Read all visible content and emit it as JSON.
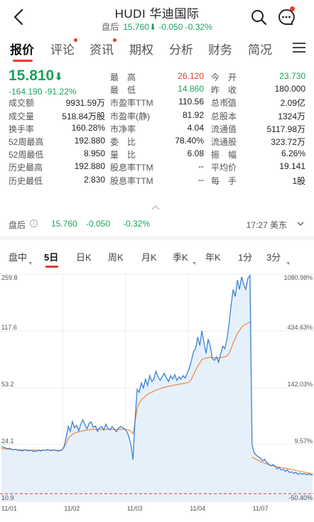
{
  "header": {
    "title": "HUDI 华迪国际",
    "after_hours_label": "盘后",
    "after_hours_price": "15.760",
    "after_hours_change": "-0.050",
    "after_hours_pct": "-0.32%"
  },
  "tabs": [
    {
      "label": "报价",
      "active": true
    },
    {
      "label": "评论",
      "dot": true
    },
    {
      "label": "资讯",
      "dot": true
    },
    {
      "label": "期权"
    },
    {
      "label": "分析"
    },
    {
      "label": "财务"
    },
    {
      "label": "简况"
    }
  ],
  "quote": {
    "price": "15.810",
    "change": "-164.190",
    "change_pct": "-91.22%",
    "col2": [
      {
        "label": "最　高",
        "value": "26.120",
        "color": "red"
      },
      {
        "label": "最　低",
        "value": "14.860",
        "color": "green"
      },
      {
        "label": "市盈率TTM",
        "value": "110.56"
      },
      {
        "label": "市盈率(静)",
        "value": "81.92"
      },
      {
        "label": "市净率",
        "value": "4.04"
      },
      {
        "label": "委　比",
        "value": "78.40%"
      },
      {
        "label": "量　比",
        "value": "6.08"
      },
      {
        "label": "股息率TTM",
        "value": "--"
      },
      {
        "label": "股息率TTM",
        "value": "--"
      }
    ],
    "col1": [
      {
        "label": "成交额",
        "value": "9931.59万"
      },
      {
        "label": "成交量",
        "value": "518.84万股"
      },
      {
        "label": "换手率",
        "value": "160.28%"
      },
      {
        "label": "52周最高",
        "value": "192.880"
      },
      {
        "label": "52周最低",
        "value": "8.950"
      },
      {
        "label": "历史最高",
        "value": "192.880"
      },
      {
        "label": "历史最低",
        "value": "2.830"
      }
    ],
    "col3": [
      {
        "label": "今　开",
        "value": "23.730",
        "color": "green"
      },
      {
        "label": "昨　收",
        "value": "180.000"
      },
      {
        "label": "总市值",
        "value": "2.09亿",
        "info": true
      },
      {
        "label": "总股本",
        "value": "1324万"
      },
      {
        "label": "流通值",
        "value": "5117.98万"
      },
      {
        "label": "流通股",
        "value": "323.72万"
      },
      {
        "label": "振　幅",
        "value": "6.26%"
      },
      {
        "label": "平均价",
        "value": "19.141"
      },
      {
        "label": "每　手",
        "value": "1股"
      }
    ]
  },
  "after_hours_row": {
    "label": "盘后",
    "price": "15.760",
    "change": "-0.050",
    "pct": "-0.32%",
    "time": "17:27 美东"
  },
  "chart_tabs": [
    {
      "label": "盘中",
      "dropdown": true
    },
    {
      "label": "5日",
      "active": true
    },
    {
      "label": "日K"
    },
    {
      "label": "周K"
    },
    {
      "label": "月K"
    },
    {
      "label": "季K",
      "dropdown": true
    },
    {
      "label": "年K"
    },
    {
      "label": "1分"
    },
    {
      "label": "3分",
      "dropdown": true
    }
  ],
  "chart_data": {
    "type": "line",
    "y_left_ticks": [
      "259.8",
      "117.6",
      "53.2",
      "24.1",
      "10.9"
    ],
    "y_right_ticks": [
      "1080.98%",
      "434.63%",
      "142.03%",
      "9.57%",
      "-50.40%"
    ],
    "x_dates": [
      "11/01",
      "11/02",
      "11/03",
      "11/04",
      "11/07"
    ],
    "ylim": [
      10.9,
      259.8
    ],
    "log_scale": true,
    "prev_close": 22.0,
    "series": [
      {
        "color": "#3b82d6",
        "values": [
          23.5,
          23.2,
          23.0,
          22.7,
          22.9,
          22.5,
          22.4,
          22.6,
          22.2,
          22.3,
          22.0,
          22.4,
          22.2,
          22.1,
          22.3,
          22.0,
          21.9,
          22.1,
          22.2,
          22.0,
          22.4,
          22.2,
          22.5,
          22.3,
          22.1,
          22.4,
          22.2,
          22.0,
          22.1,
          22.3,
          23.4,
          26.5,
          31.0,
          29.0,
          33.2,
          30.5,
          31.5,
          29.2,
          32.0,
          34.0,
          31.8,
          30.0,
          32.5,
          33.0,
          30.6,
          31.2,
          29.0,
          30.5,
          31.0,
          29.5,
          32.0,
          30.2,
          29.6,
          31.0,
          30.0,
          28.8,
          30.2,
          31.0,
          30.5,
          30.0,
          29.0,
          27.0,
          24.0,
          19.5,
          34.0,
          52.0,
          50.0,
          57.0,
          53.0,
          60.0,
          55.0,
          63.0,
          58.0,
          60.0,
          67.0,
          62.0,
          59.0,
          62.0,
          65.0,
          61.0,
          58.0,
          63.0,
          60.0,
          64.0,
          59.0,
          62.0,
          60.0,
          63.0,
          61.0,
          65.0,
          70.0,
          78.0,
          88.0,
          92.0,
          108.0,
          96.0,
          118.0,
          100.0,
          86.0,
          105.0,
          95.0,
          80.0,
          78.0,
          82.0,
          76.0,
          86.0,
          95.0,
          92.0,
          105.0,
          130.0,
          170.0,
          210.0,
          190.0,
          240.0,
          210.0,
          250.0,
          225.0,
          210.0,
          245.0,
          255.0,
          24.0,
          21.5,
          20.8,
          20.3,
          20.0,
          19.2,
          19.6,
          18.8,
          18.4,
          17.9,
          18.2,
          17.8,
          17.2,
          17.5,
          16.9,
          17.1,
          16.6,
          16.9,
          16.3,
          16.5,
          16.1,
          16.4,
          15.9,
          16.2,
          15.9,
          16.1,
          15.8,
          16.0,
          15.8,
          15.8
        ]
      },
      {
        "color": "#f0883c",
        "values": [
          22.8,
          22.7,
          22.7,
          22.6,
          22.6,
          22.5,
          22.5,
          22.5,
          22.4,
          22.4,
          22.4,
          22.4,
          22.4,
          22.3,
          22.3,
          22.3,
          22.3,
          22.3,
          22.3,
          22.3,
          22.3,
          22.3,
          22.3,
          22.3,
          22.3,
          22.3,
          22.3,
          22.3,
          22.3,
          22.3,
          23.2,
          24.5,
          26.2,
          27.0,
          27.8,
          28.2,
          28.6,
          28.8,
          29.0,
          29.2,
          29.4,
          29.5,
          29.6,
          29.7,
          29.8,
          29.8,
          29.8,
          29.8,
          29.8,
          29.8,
          29.8,
          29.8,
          29.8,
          29.8,
          29.8,
          29.8,
          29.8,
          29.8,
          29.8,
          29.8,
          29.7,
          29.5,
          29.0,
          28.0,
          33.0,
          40.0,
          43.0,
          45.0,
          46.0,
          47.5,
          48.5,
          49.5,
          50.0,
          50.8,
          51.5,
          52.0,
          52.5,
          53.0,
          53.5,
          54.0,
          54.2,
          54.6,
          55.0,
          55.3,
          55.6,
          55.9,
          56.2,
          56.5,
          56.8,
          57.0,
          58.0,
          60.0,
          64.0,
          68.0,
          72.0,
          75.0,
          79.0,
          80.0,
          80.5,
          81.0,
          81.5,
          81.2,
          81.0,
          80.8,
          80.5,
          80.8,
          81.5,
          82.0,
          83.0,
          86.0,
          92.0,
          100.0,
          106.0,
          114.0,
          118.0,
          124.0,
          127.0,
          129.0,
          131.0,
          133.0,
          20.2,
          19.9,
          19.6,
          19.3,
          19.0,
          18.8,
          18.6,
          18.4,
          18.2,
          18.0,
          17.9,
          17.8,
          17.7,
          17.6,
          17.5,
          17.4,
          17.3,
          17.2,
          17.1,
          17.0,
          16.9,
          16.8,
          16.7,
          16.6,
          16.5,
          16.4,
          16.3,
          16.2,
          16.1,
          16.0
        ]
      }
    ]
  },
  "colors": {
    "accent_red": "#e73b2f",
    "down_green": "#1aa35c",
    "line_blue": "#3b82d6",
    "avg_orange": "#f0883c"
  }
}
